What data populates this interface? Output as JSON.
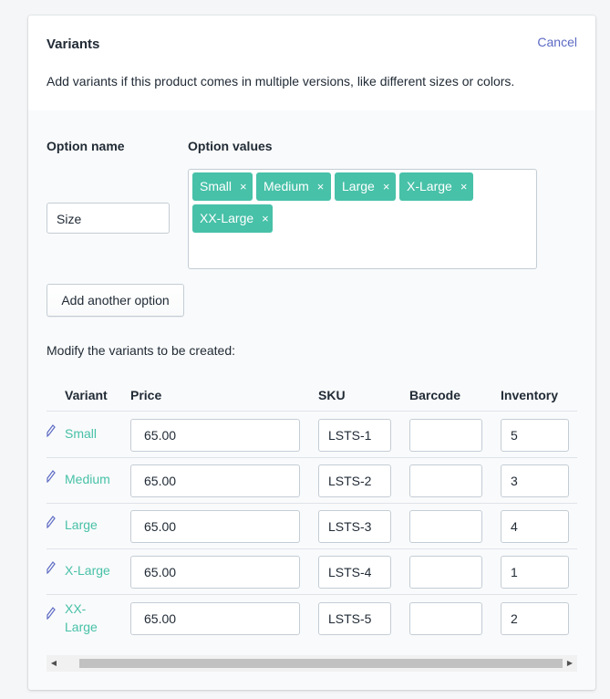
{
  "header": {
    "title": "Variants",
    "cancel_label": "Cancel",
    "description": "Add variants if this product comes in multiple versions, like different sizes or colors."
  },
  "options": {
    "name_label": "Option name",
    "values_label": "Option values",
    "name_value": "Size",
    "tags": [
      "Small",
      "Medium",
      "Large",
      "X-Large",
      "XX-Large"
    ],
    "remove_glyph": "×",
    "add_button_label": "Add another option"
  },
  "variants": {
    "modify_label": "Modify the variants to be created:",
    "columns": [
      "Variant",
      "Price",
      "SKU",
      "Barcode",
      "Inventory"
    ],
    "rows": [
      {
        "name": "Small",
        "price": "65.00",
        "sku": "LSTS-1",
        "barcode": "",
        "inventory": "5"
      },
      {
        "name": "Medium",
        "price": "65.00",
        "sku": "LSTS-2",
        "barcode": "",
        "inventory": "3"
      },
      {
        "name": "Large",
        "price": "65.00",
        "sku": "LSTS-3",
        "barcode": "",
        "inventory": "4"
      },
      {
        "name": "X-Large",
        "price": "65.00",
        "sku": "LSTS-4",
        "barcode": "",
        "inventory": "1"
      },
      {
        "name": "XX-Large",
        "price": "65.00",
        "sku": "LSTS-5",
        "barcode": "",
        "inventory": "2"
      }
    ]
  },
  "colors": {
    "accent_link": "#5c6ac4",
    "tag_green": "#47c1a8",
    "variant_green": "#47c1a8"
  }
}
